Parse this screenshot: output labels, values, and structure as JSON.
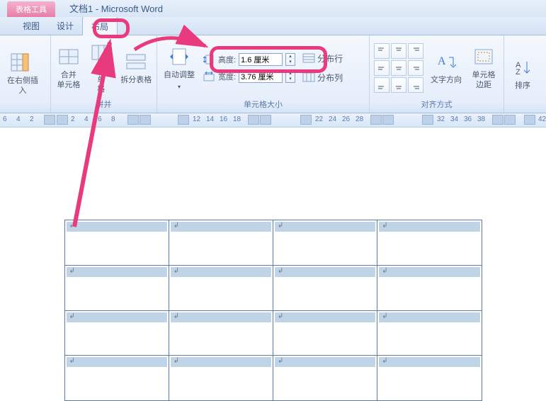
{
  "title": {
    "contextual_tab": "表格工具",
    "window_title": "文档1 - Microsoft Word"
  },
  "tabs": {
    "view": "视图",
    "design": "设计",
    "layout": "布局"
  },
  "ribbon": {
    "insert_right": "在右侧插入",
    "merge_cells": "合并\n单元格",
    "split_cells": "拆\n单\n格",
    "split_table": "拆分表格",
    "autofit": "自动调整",
    "height_label": "高度:",
    "height_value": "1.6 厘米",
    "width_label": "宽度:",
    "width_value": "3.76 厘米",
    "dist_rows": "分布行",
    "dist_cols": "分布列",
    "text_direction": "文字方向",
    "cell_margins": "单元格\n边距",
    "sort": "排序",
    "group_merge": "拼并",
    "group_cellsize": "单元格大小",
    "group_align": "对齐方式"
  },
  "ruler": {
    "ticks": [
      "6",
      "4",
      "2",
      "2",
      "4",
      "6",
      "8",
      "12",
      "14",
      "16",
      "18",
      "22",
      "24",
      "26",
      "28",
      "32",
      "34",
      "36",
      "38",
      "42"
    ],
    "positions": [
      4,
      23,
      42,
      100,
      119,
      138,
      157,
      272,
      291,
      310,
      329,
      445,
      464,
      483,
      502,
      617,
      636,
      655,
      674,
      760
    ],
    "marks": [
      62,
      80,
      180,
      197,
      251,
      350,
      367,
      424,
      523,
      540,
      596,
      695,
      712,
      740
    ]
  },
  "table": {
    "rows": 4,
    "cols": 4
  }
}
